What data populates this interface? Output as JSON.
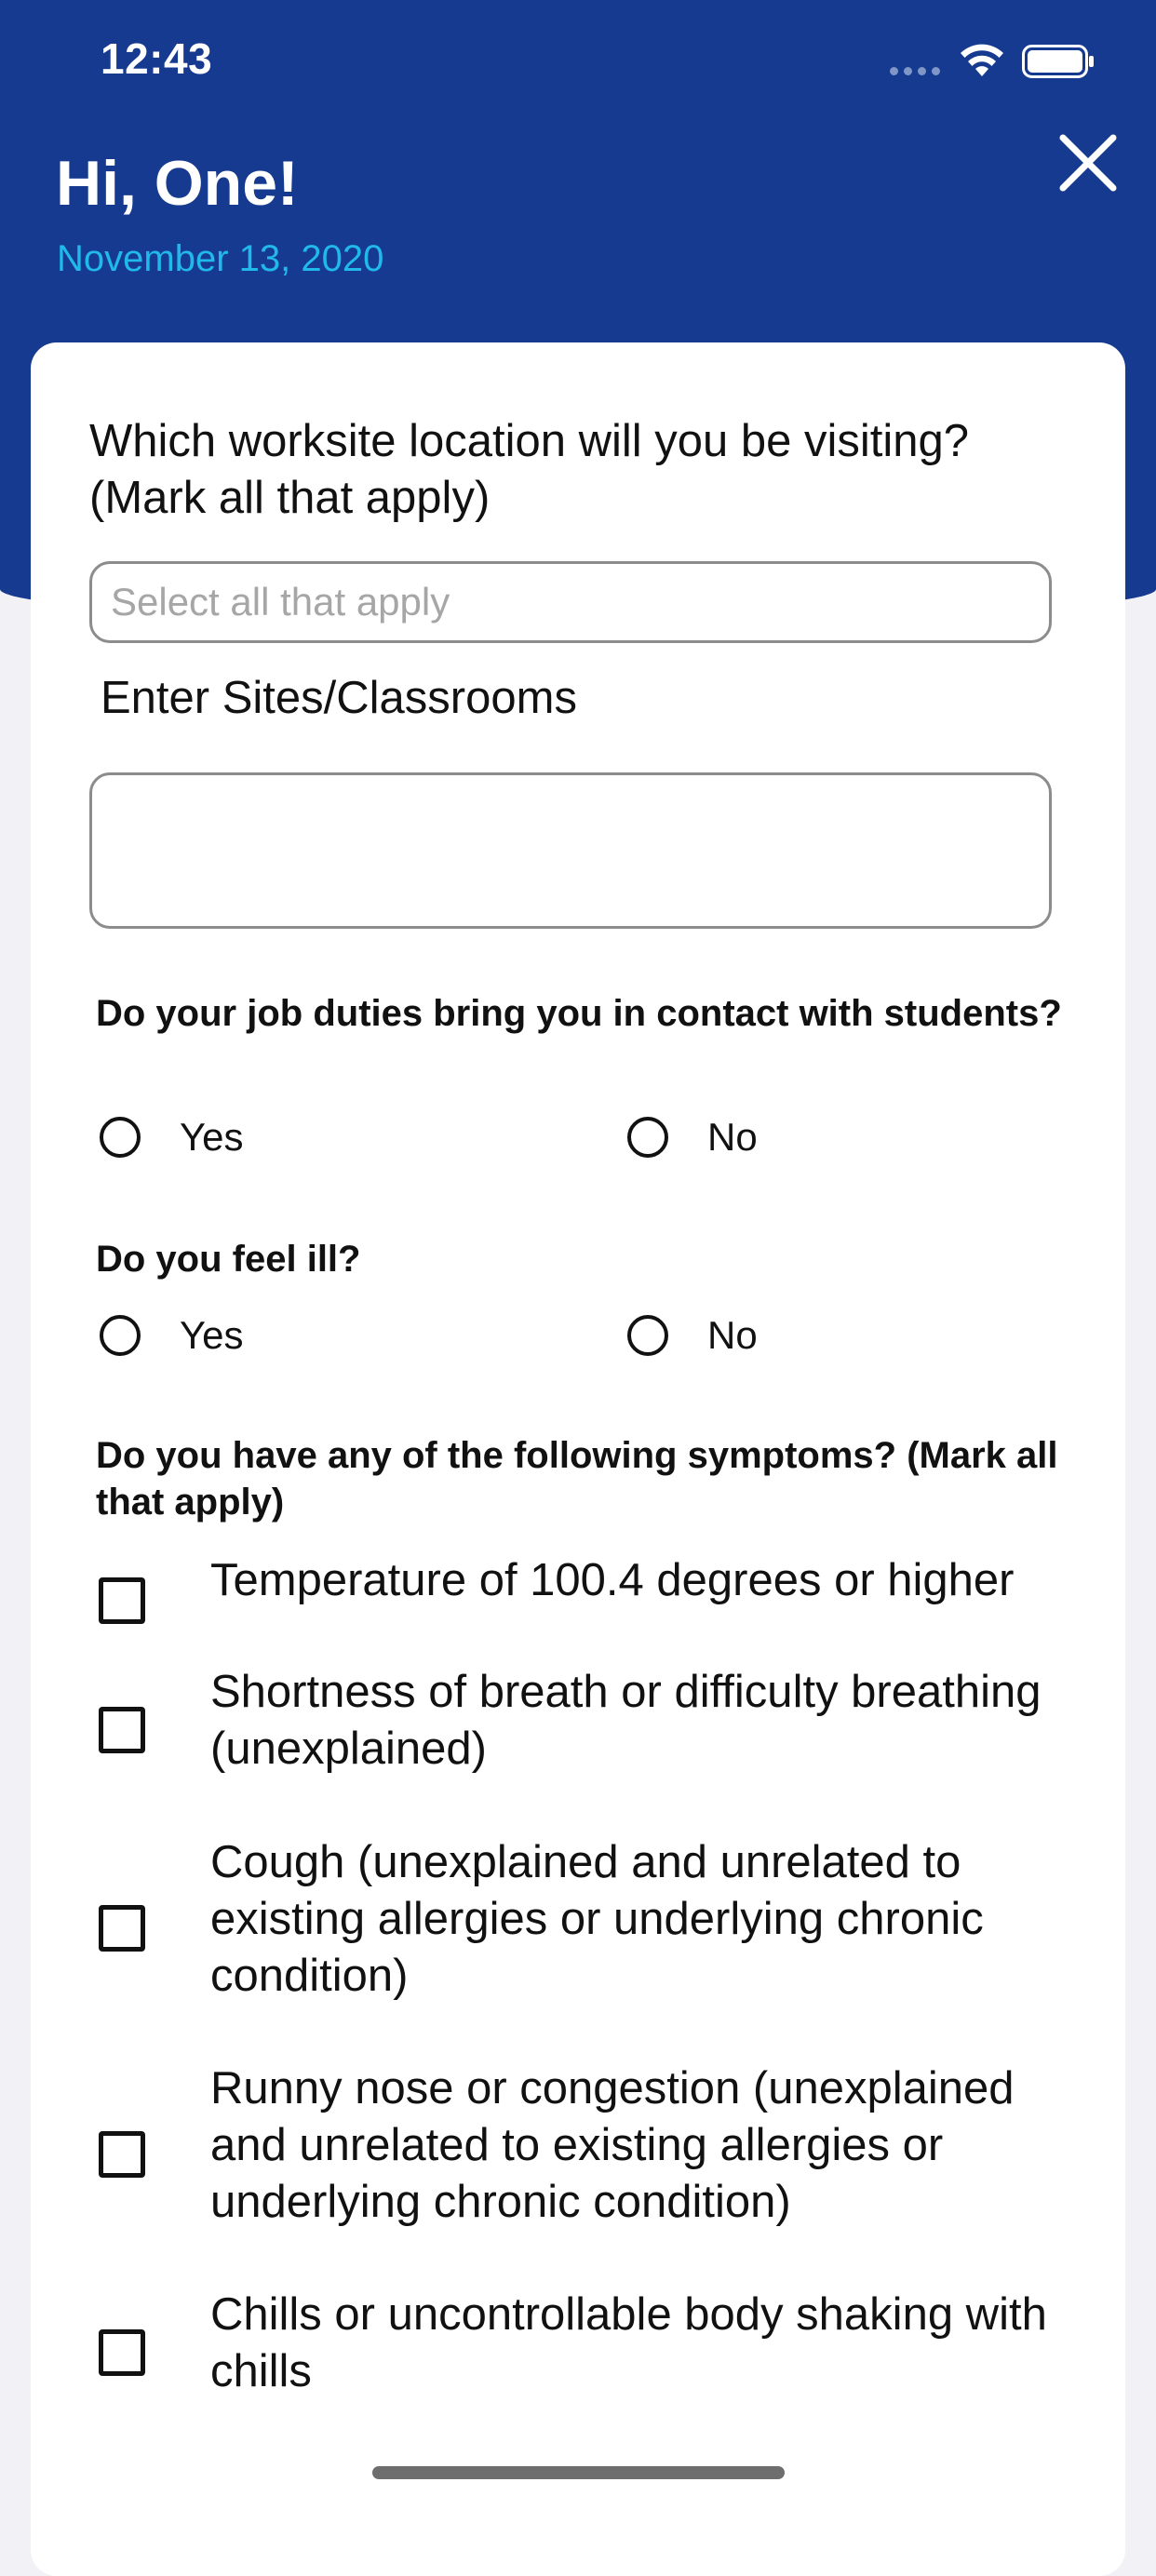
{
  "status_bar": {
    "time": "12:43"
  },
  "header": {
    "greeting": "Hi, One!",
    "date": "November 13, 2020",
    "close_icon": "close-icon"
  },
  "form": {
    "worksite_question": "Which worksite location will you be visiting? (Mark all that apply)",
    "worksite_placeholder": "Select all that apply",
    "sites_label": "Enter Sites/Classrooms",
    "sites_value": "",
    "contact_question": "Do your job duties bring you in contact with students?",
    "contact_options": [
      "Yes",
      "No"
    ],
    "ill_question": "Do you feel ill?",
    "ill_options": [
      "Yes",
      "No"
    ],
    "symptoms_question": "Do you have any of the following symptoms? (Mark all that apply)",
    "symptoms": [
      "Temperature of 100.4 degrees or higher",
      "Shortness of breath or difficulty breathing (unexplained)",
      "Cough (unexplained and unrelated to existing allergies or underlying chronic condition)",
      "Runny nose or congestion (unexplained and unrelated to existing allergies or underlying chronic condition)",
      "Chills or uncontrollable body shaking with chills"
    ]
  },
  "colors": {
    "header_bg": "#163a8f",
    "date_accent": "#20b9ea"
  }
}
